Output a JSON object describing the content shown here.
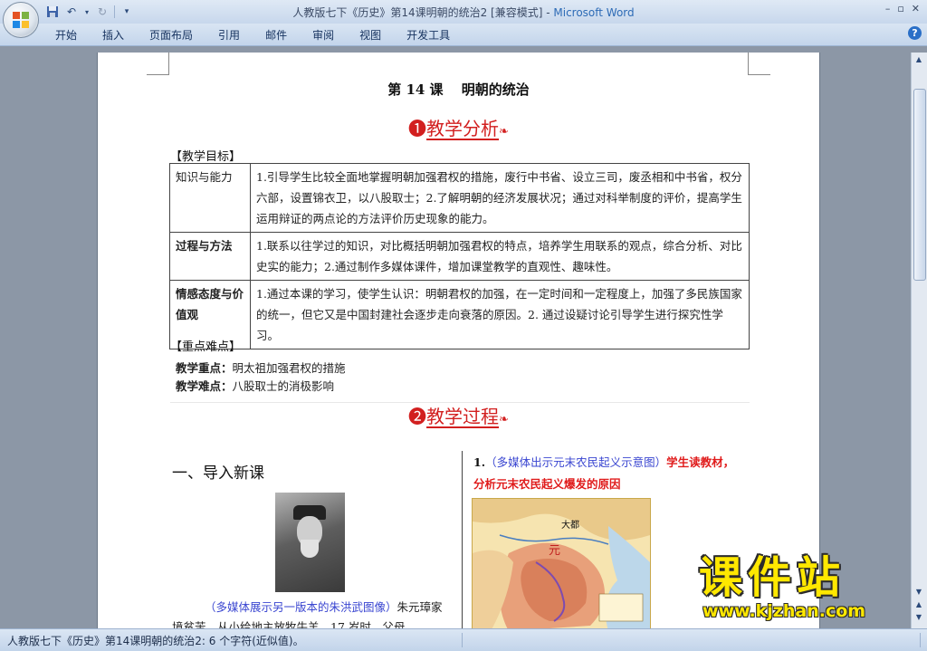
{
  "window": {
    "title": "人教版七下《历史》第14课明朝的统治2 [兼容模式] - ",
    "app_name": "Microsoft Word",
    "controls": [
      "–",
      "▫",
      "✕"
    ]
  },
  "ribbon": {
    "tabs": [
      "开始",
      "插入",
      "页面布局",
      "引用",
      "邮件",
      "审阅",
      "视图",
      "开发工具"
    ],
    "help": "?"
  },
  "document": {
    "lesson_title": "第 14 课　 明朝的统治",
    "section1": {
      "badge": "❶",
      "title": "教学分析",
      "deco": "❧"
    },
    "goals_label": "【教学目标】",
    "goals": [
      {
        "key": "知识与能力",
        "text": "1.引导学生比较全面地掌握明朝加强君权的措施，废行中书省、设立三司，废丞相和中书省，权分六部，设置锦衣卫，以八股取士；2.了解明朝的经济发展状况；通过对科举制度的评价，提高学生运用辩证的两点论的方法评价历史现象的能力。"
      },
      {
        "key": "过程与方法",
        "text": "1.联系以往学过的知识，对比概括明朝加强君权的特点，培养学生用联系的观点，综合分析、对比史实的能力；2.通过制作多媒体课件，增加课堂教学的直观性、趣味性。"
      },
      {
        "key": "情感态度与价值观",
        "text": "1.通过本课的学习，使学生认识：明朝君权的加强，在一定时间和一定程度上，加强了多民族国家的统一，但它又是中国封建社会逐步走向衰落的原因。2. 通过设疑讨论引导学生进行探究性学习。"
      }
    ],
    "keypoints_label": "【重点难点】",
    "key_point_label": "教学重点：",
    "key_point": "明太祖加强君权的措施",
    "difficulty_label": "教学难点：",
    "difficulty": "八股取士的消极影响",
    "section2": {
      "badge": "❷",
      "title": "教学过程",
      "deco": "❧"
    },
    "intro_head": "一、导入新课",
    "caption_blue": "（多媒体展示另一版本的朱洪武图像）",
    "caption_rest": "朱元璋家境贫苦，从小给地主放牧牛羊，17 岁时，父母",
    "right_num": "1.",
    "right_blue": "（多媒体出示元末农民起义示意图）",
    "right_red": "学生读教材，分析元末农民起义爆发的原因",
    "map_labels": {
      "capital": "大都",
      "yuan": "元"
    }
  },
  "watermark": {
    "cn": "课件站",
    "url": "www.kjzhan.com"
  },
  "status_bar": {
    "text": "人教版七下《历史》第14课明朝的统治2: 6 个字符(近似值)。"
  },
  "colors": {
    "accent_red": "#d21f1f",
    "link_blue": "#3a46d1",
    "watermark_yellow": "#ffe800"
  }
}
